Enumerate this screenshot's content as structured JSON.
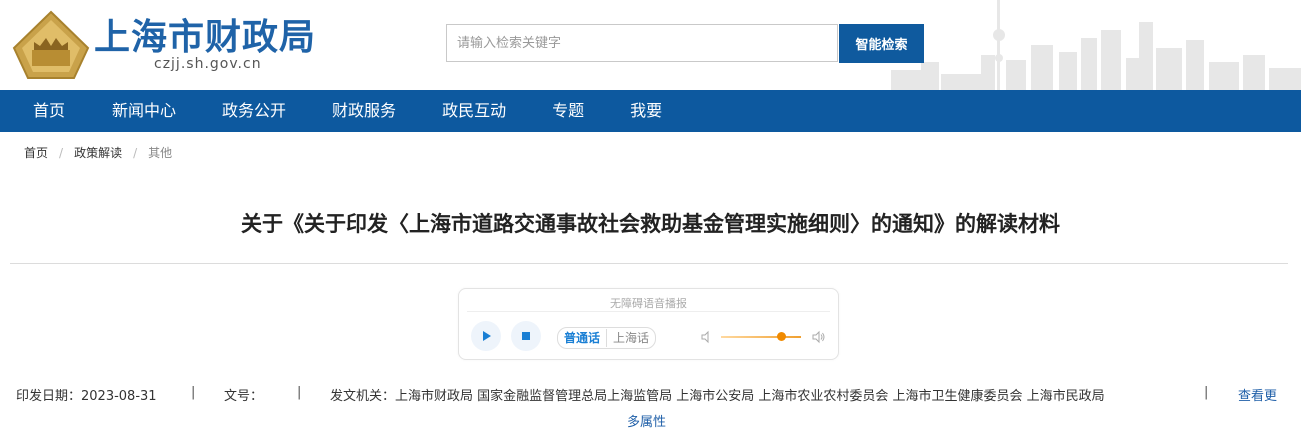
{
  "site": {
    "title": "上海市财政局",
    "domain": "czjj.sh.gov.cn"
  },
  "search": {
    "placeholder": "请输入检索关键字",
    "button_label": "智能检索"
  },
  "nav": {
    "items": [
      "首页",
      "新闻中心",
      "政务公开",
      "财政服务",
      "政民互动",
      "专题",
      "我要"
    ]
  },
  "breadcrumb": {
    "items": [
      "首页",
      "政策解读",
      "其他"
    ]
  },
  "article": {
    "title": "关于《关于印发〈上海市道路交通事故社会救助基金管理实施细则〉的通知》的解读材料"
  },
  "player": {
    "label": "无障碍语音播报",
    "lang_mandarin": "普通话",
    "lang_shanghainese": "上海话",
    "volume_level": 0.75,
    "icons": [
      "play-icon",
      "stop-icon",
      "volume-low-icon",
      "volume-high-icon"
    ]
  },
  "meta": {
    "date_label": "印发日期：2023-08-31",
    "separator": "|",
    "doc_no_label": "文号：",
    "issuer_label": "发文机关：上海市财政局 国家金融监督管理总局上海监管局 上海市公安局 上海市农业农村委员会 上海市卫生健康委员会 上海市民政局",
    "more_line1": "查看更",
    "more_line2": "多属性"
  },
  "colors": {
    "brand_blue": "#0d599f",
    "logo_gold": "#c9a24a",
    "link_blue": "#1f5fa8"
  }
}
